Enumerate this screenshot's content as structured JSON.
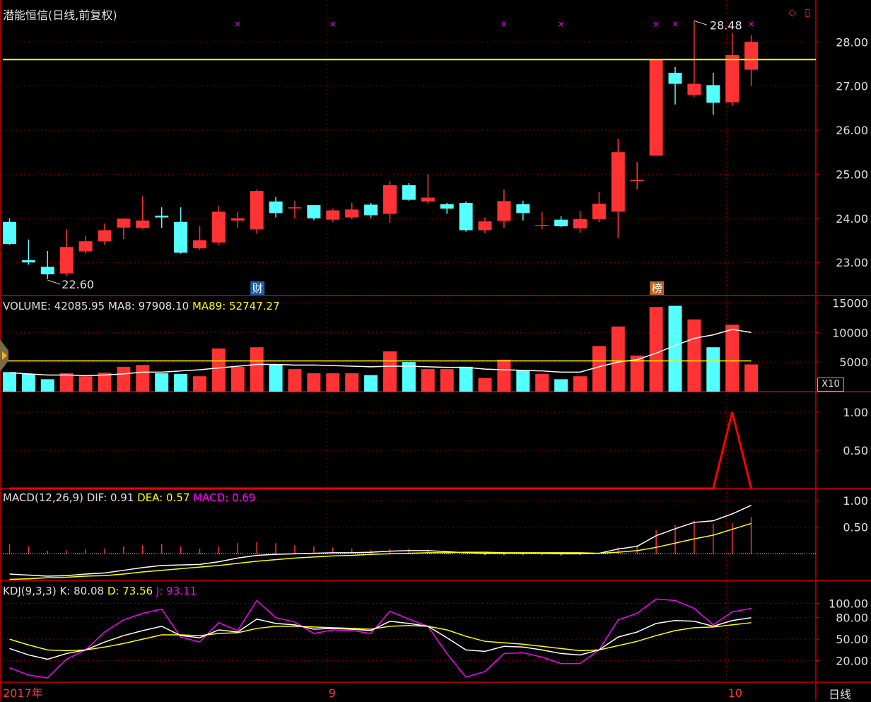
{
  "title": "潜能恒信(日线,前复权)",
  "window_icons": "◇ ▯",
  "period_label": "日线",
  "x10_label": "X10",
  "x_labels": [
    {
      "label": "2017年",
      "index": 0
    },
    {
      "label": "9",
      "index": 17
    },
    {
      "label": "10",
      "index": 38
    }
  ],
  "event_tags": [
    {
      "label": "财",
      "index": 13,
      "color": "#1e5fa8"
    },
    {
      "label": "榜",
      "index": 34,
      "color": "#b8641e"
    }
  ],
  "price_marks": {
    "high": "28.48",
    "high_index": 36,
    "low": "22.60",
    "low_index": 2
  },
  "price_line": 27.6,
  "markers": [
    12,
    17,
    26,
    29,
    34,
    35,
    39
  ],
  "colors": {
    "up": "#ff3333",
    "down": "#54ffff",
    "grid": "#8b0000",
    "text": "#e0e0e0",
    "yellow": "#ffff00",
    "magenta": "#ff00ff"
  },
  "chart_data": [
    {
      "type": "candlestick",
      "series_name": "price",
      "yticks": [
        "23.00",
        "24.00",
        "25.00",
        "26.00",
        "27.00",
        "28.00"
      ],
      "ylim": [
        22.25,
        28.95
      ],
      "candles": [
        {
          "o": 23.92,
          "h": 24.0,
          "l": 23.4,
          "c": 23.42
        },
        {
          "o": 23.05,
          "h": 23.52,
          "l": 22.95,
          "c": 23.0
        },
        {
          "o": 22.9,
          "h": 23.26,
          "l": 22.62,
          "c": 22.73
        },
        {
          "o": 22.75,
          "h": 23.75,
          "l": 22.7,
          "c": 23.35
        },
        {
          "o": 23.25,
          "h": 23.6,
          "l": 23.2,
          "c": 23.48
        },
        {
          "o": 23.48,
          "h": 23.88,
          "l": 23.4,
          "c": 23.73
        },
        {
          "o": 23.79,
          "h": 24.0,
          "l": 23.53,
          "c": 23.99
        },
        {
          "o": 23.78,
          "h": 24.5,
          "l": 23.76,
          "c": 23.95
        },
        {
          "o": 24.06,
          "h": 24.25,
          "l": 23.78,
          "c": 24.02
        },
        {
          "o": 23.92,
          "h": 24.25,
          "l": 23.2,
          "c": 23.22
        },
        {
          "o": 23.32,
          "h": 23.82,
          "l": 23.28,
          "c": 23.5
        },
        {
          "o": 23.45,
          "h": 24.28,
          "l": 23.4,
          "c": 24.15
        },
        {
          "o": 23.95,
          "h": 24.15,
          "l": 23.78,
          "c": 24.0
        },
        {
          "o": 23.75,
          "h": 24.65,
          "l": 23.65,
          "c": 24.62
        },
        {
          "o": 24.38,
          "h": 24.48,
          "l": 24.02,
          "c": 24.12
        },
        {
          "o": 24.25,
          "h": 24.4,
          "l": 24.0,
          "c": 24.25
        },
        {
          "o": 24.3,
          "h": 24.3,
          "l": 23.96,
          "c": 24.0
        },
        {
          "o": 23.97,
          "h": 24.22,
          "l": 23.92,
          "c": 24.18
        },
        {
          "o": 24.02,
          "h": 24.35,
          "l": 23.98,
          "c": 24.2
        },
        {
          "o": 24.31,
          "h": 24.35,
          "l": 24.0,
          "c": 24.07
        },
        {
          "o": 24.1,
          "h": 24.85,
          "l": 23.9,
          "c": 24.75
        },
        {
          "o": 24.75,
          "h": 24.8,
          "l": 24.4,
          "c": 24.42
        },
        {
          "o": 24.38,
          "h": 25.0,
          "l": 24.33,
          "c": 24.47
        },
        {
          "o": 24.32,
          "h": 24.35,
          "l": 24.1,
          "c": 24.22
        },
        {
          "o": 24.35,
          "h": 24.38,
          "l": 23.7,
          "c": 23.73
        },
        {
          "o": 23.73,
          "h": 24.02,
          "l": 23.66,
          "c": 23.93
        },
        {
          "o": 23.94,
          "h": 24.65,
          "l": 23.78,
          "c": 24.39
        },
        {
          "o": 24.32,
          "h": 24.4,
          "l": 23.95,
          "c": 24.12
        },
        {
          "o": 23.85,
          "h": 24.15,
          "l": 23.75,
          "c": 23.85
        },
        {
          "o": 23.97,
          "h": 24.05,
          "l": 23.8,
          "c": 23.82
        },
        {
          "o": 23.77,
          "h": 24.17,
          "l": 23.67,
          "c": 23.98
        },
        {
          "o": 23.98,
          "h": 24.6,
          "l": 23.91,
          "c": 24.33
        },
        {
          "o": 24.15,
          "h": 25.8,
          "l": 23.55,
          "c": 25.5
        },
        {
          "o": 24.87,
          "h": 25.28,
          "l": 24.65,
          "c": 24.87
        },
        {
          "o": 25.42,
          "h": 27.6,
          "l": 25.42,
          "c": 27.6
        },
        {
          "o": 27.3,
          "h": 27.43,
          "l": 26.58,
          "c": 27.05
        },
        {
          "o": 26.8,
          "h": 28.48,
          "l": 26.75,
          "c": 27.05
        },
        {
          "o": 27.02,
          "h": 27.3,
          "l": 26.35,
          "c": 26.62
        },
        {
          "o": 26.63,
          "h": 28.2,
          "l": 26.55,
          "c": 27.7
        },
        {
          "o": 27.37,
          "h": 28.15,
          "l": 27.0,
          "c": 28.0
        }
      ]
    },
    {
      "type": "bar",
      "series_name": "volume",
      "header": {
        "name": "VOLUME:",
        "value": "42085.95",
        "ma8": "MA8: 97908.10",
        "ma89": "MA89: 52747.27"
      },
      "yticks": [
        "5000",
        "10000",
        "15000"
      ],
      "ylim": [
        0,
        16000
      ],
      "values": [
        3300,
        3000,
        2100,
        3100,
        2600,
        3200,
        4200,
        4500,
        3100,
        3000,
        2600,
        7300,
        4200,
        7500,
        4600,
        3800,
        3100,
        3100,
        3100,
        2800,
        6800,
        5000,
        3800,
        3800,
        4200,
        2300,
        5400,
        3600,
        3000,
        2100,
        2600,
        7700,
        11000,
        6100,
        14300,
        14500,
        12200,
        7500,
        11300,
        4600
      ],
      "up": [
        false,
        false,
        false,
        true,
        true,
        true,
        true,
        true,
        false,
        false,
        true,
        true,
        true,
        true,
        false,
        true,
        true,
        true,
        true,
        false,
        true,
        false,
        true,
        true,
        false,
        true,
        true,
        false,
        true,
        false,
        true,
        true,
        true,
        true,
        true,
        false,
        true,
        false,
        true,
        true
      ],
      "ma8": [
        3200,
        3000,
        2800,
        2800,
        2700,
        2800,
        3000,
        3300,
        3300,
        3500,
        3700,
        4000,
        4300,
        4600,
        4600,
        4500,
        4500,
        4400,
        4300,
        4200,
        4300,
        4300,
        4200,
        4100,
        4100,
        3800,
        3700,
        3600,
        3500,
        3300,
        3300,
        4200,
        5000,
        5400,
        6500,
        7800,
        9000,
        9600,
        10500,
        10000
      ],
      "ma89": 5200
    },
    {
      "type": "line",
      "series_name": "signal",
      "yticks": [
        "0.50",
        "1.00"
      ],
      "ylim": [
        0,
        1.25
      ],
      "values": [
        0,
        0,
        0,
        0,
        0,
        0,
        0,
        0,
        0,
        0,
        0,
        0,
        0,
        0,
        0,
        0,
        0,
        0,
        0,
        0,
        0,
        0,
        0,
        0,
        0,
        0,
        0,
        0,
        0,
        0,
        0,
        0,
        0,
        0,
        0,
        0,
        0,
        0,
        1,
        0
      ]
    },
    {
      "type": "line",
      "series_name": "MACD",
      "header": {
        "name": "MACD(12,26,9)",
        "dif": "DIF: 0.91",
        "dea": "DEA: 0.57",
        "macd": "MACD: 0.69"
      },
      "yticks": [
        "0.50",
        "1.00"
      ],
      "ylim": [
        -0.5,
        1.2
      ],
      "dif": [
        -0.38,
        -0.4,
        -0.42,
        -0.41,
        -0.38,
        -0.36,
        -0.31,
        -0.26,
        -0.22,
        -0.21,
        -0.2,
        -0.15,
        -0.08,
        -0.03,
        -0.01,
        0.0,
        0.01,
        0.02,
        0.02,
        0.03,
        0.05,
        0.06,
        0.06,
        0.04,
        0.02,
        0.01,
        0.01,
        0.01,
        0.01,
        0.0,
        0.0,
        0.01,
        0.09,
        0.14,
        0.34,
        0.47,
        0.59,
        0.62,
        0.75,
        0.91
      ],
      "dea": [
        -0.48,
        -0.47,
        -0.45,
        -0.44,
        -0.42,
        -0.41,
        -0.38,
        -0.34,
        -0.31,
        -0.28,
        -0.25,
        -0.22,
        -0.18,
        -0.14,
        -0.11,
        -0.08,
        -0.06,
        -0.04,
        -0.03,
        -0.01,
        0.0,
        0.01,
        0.02,
        0.02,
        0.03,
        0.03,
        0.02,
        0.02,
        0.02,
        0.02,
        0.02,
        0.01,
        0.03,
        0.06,
        0.12,
        0.2,
        0.28,
        0.35,
        0.46,
        0.57
      ],
      "macd": [
        0.18,
        0.14,
        0.06,
        0.06,
        0.08,
        0.1,
        0.14,
        0.16,
        0.18,
        0.14,
        0.1,
        0.14,
        0.2,
        0.22,
        0.2,
        0.16,
        0.14,
        0.12,
        0.1,
        0.08,
        0.1,
        0.1,
        0.08,
        0.04,
        0.0,
        -0.02,
        -0.02,
        -0.02,
        -0.02,
        -0.03,
        -0.02,
        0.0,
        0.12,
        0.16,
        0.44,
        0.54,
        0.62,
        0.56,
        0.58,
        0.69
      ]
    },
    {
      "type": "line",
      "series_name": "KDJ",
      "header": {
        "name": "KDJ(9,3,3)",
        "k": "K: 80.08",
        "d": "D: 73.56",
        "j": "J: 93.11"
      },
      "yticks": [
        "20.00",
        "50.00",
        "80.00",
        "100.00"
      ],
      "ylim": [
        -10,
        130
      ],
      "k": [
        37,
        28,
        22,
        30,
        35,
        46,
        55,
        62,
        68,
        55,
        52,
        63,
        60,
        78,
        72,
        70,
        64,
        65,
        64,
        62,
        75,
        72,
        68,
        52,
        35,
        33,
        40,
        39,
        35,
        30,
        28,
        35,
        53,
        60,
        72,
        76,
        75,
        68,
        76,
        80
      ],
      "d": [
        50,
        42,
        35,
        34,
        35,
        39,
        44,
        50,
        56,
        56,
        55,
        58,
        59,
        65,
        68,
        68,
        67,
        66,
        65,
        64,
        68,
        69,
        68,
        63,
        54,
        47,
        45,
        43,
        40,
        37,
        34,
        35,
        41,
        47,
        55,
        62,
        66,
        67,
        70,
        73
      ],
      "j": [
        10,
        0,
        -4,
        22,
        35,
        60,
        77,
        86,
        92,
        53,
        46,
        73,
        62,
        104,
        80,
        74,
        58,
        63,
        62,
        58,
        89,
        78,
        68,
        30,
        -3,
        5,
        30,
        31,
        25,
        16,
        16,
        35,
        77,
        86,
        106,
        104,
        93,
        70,
        88,
        93
      ]
    }
  ]
}
